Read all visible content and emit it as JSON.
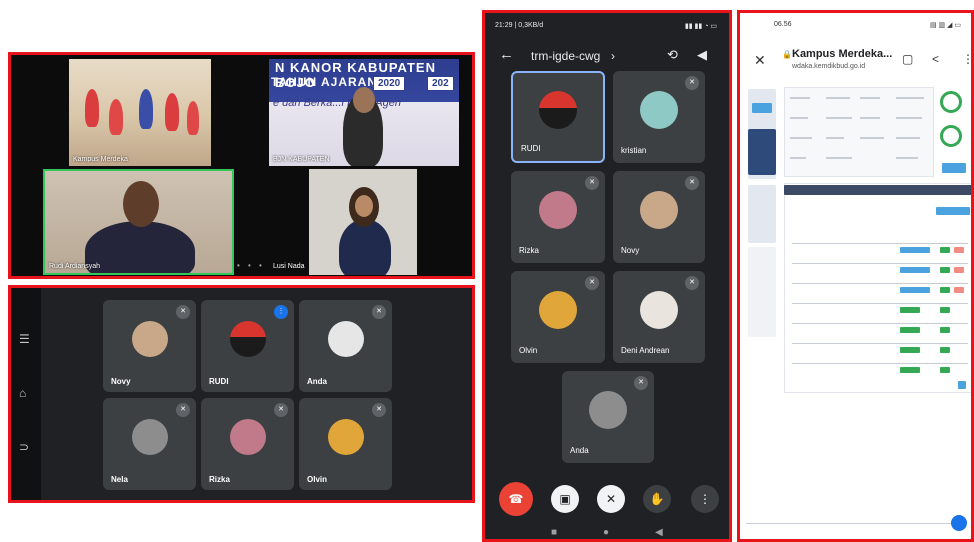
{
  "panel_video": {
    "tiles": [
      {
        "caption": "Kampus Merdeka"
      },
      {
        "caption": "BJN KABUPATEN"
      },
      {
        "caption": "Rudi Ardiansyah"
      },
      {
        "caption": "Lusi Nada"
      }
    ],
    "banner": {
      "heading": "N KANOR KABUPATEN BOJO",
      "year_label": "TAHUN AJARAN",
      "year_start": "2020",
      "year_end": "202",
      "slogan": "e dan Berka...i Demi Agen"
    }
  },
  "panel_meet_grid": {
    "nav_icons": [
      "menu-icon",
      "home-icon",
      "back-icon"
    ],
    "participants": [
      {
        "name": "Novy",
        "muted": true
      },
      {
        "name": "RUDI",
        "muted": false,
        "speaking": true
      },
      {
        "name": "Anda",
        "muted": true
      },
      {
        "name": "Nela",
        "muted": true
      },
      {
        "name": "Rizka",
        "muted": true
      },
      {
        "name": "Olvin",
        "muted": true
      }
    ]
  },
  "panel_phone_meet": {
    "status_time": "21:29 | 0,3KB/d",
    "meeting_code": "trm-igde-cwg",
    "participants": [
      {
        "name": "RUDI",
        "selected": true
      },
      {
        "name": "kristian"
      },
      {
        "name": "Rizka"
      },
      {
        "name": "Novy"
      },
      {
        "name": "Olvin"
      },
      {
        "name": "Deni Andrean"
      },
      {
        "name": "Anda"
      }
    ],
    "controls": [
      "end-call",
      "camera-off",
      "mic-off",
      "raise-hand",
      "more"
    ]
  },
  "panel_browser": {
    "status_time": "06.56",
    "page_title": "Kampus Merdeka...",
    "page_url": "wdaka.kemdikbud.go.id",
    "accent": "#4aa3df"
  },
  "colors": {
    "frame": "#e8141b",
    "meet_bg": "#202124",
    "tile_bg": "#3c4043",
    "end_call": "#ea4335",
    "speaking": "#1a73e8"
  }
}
